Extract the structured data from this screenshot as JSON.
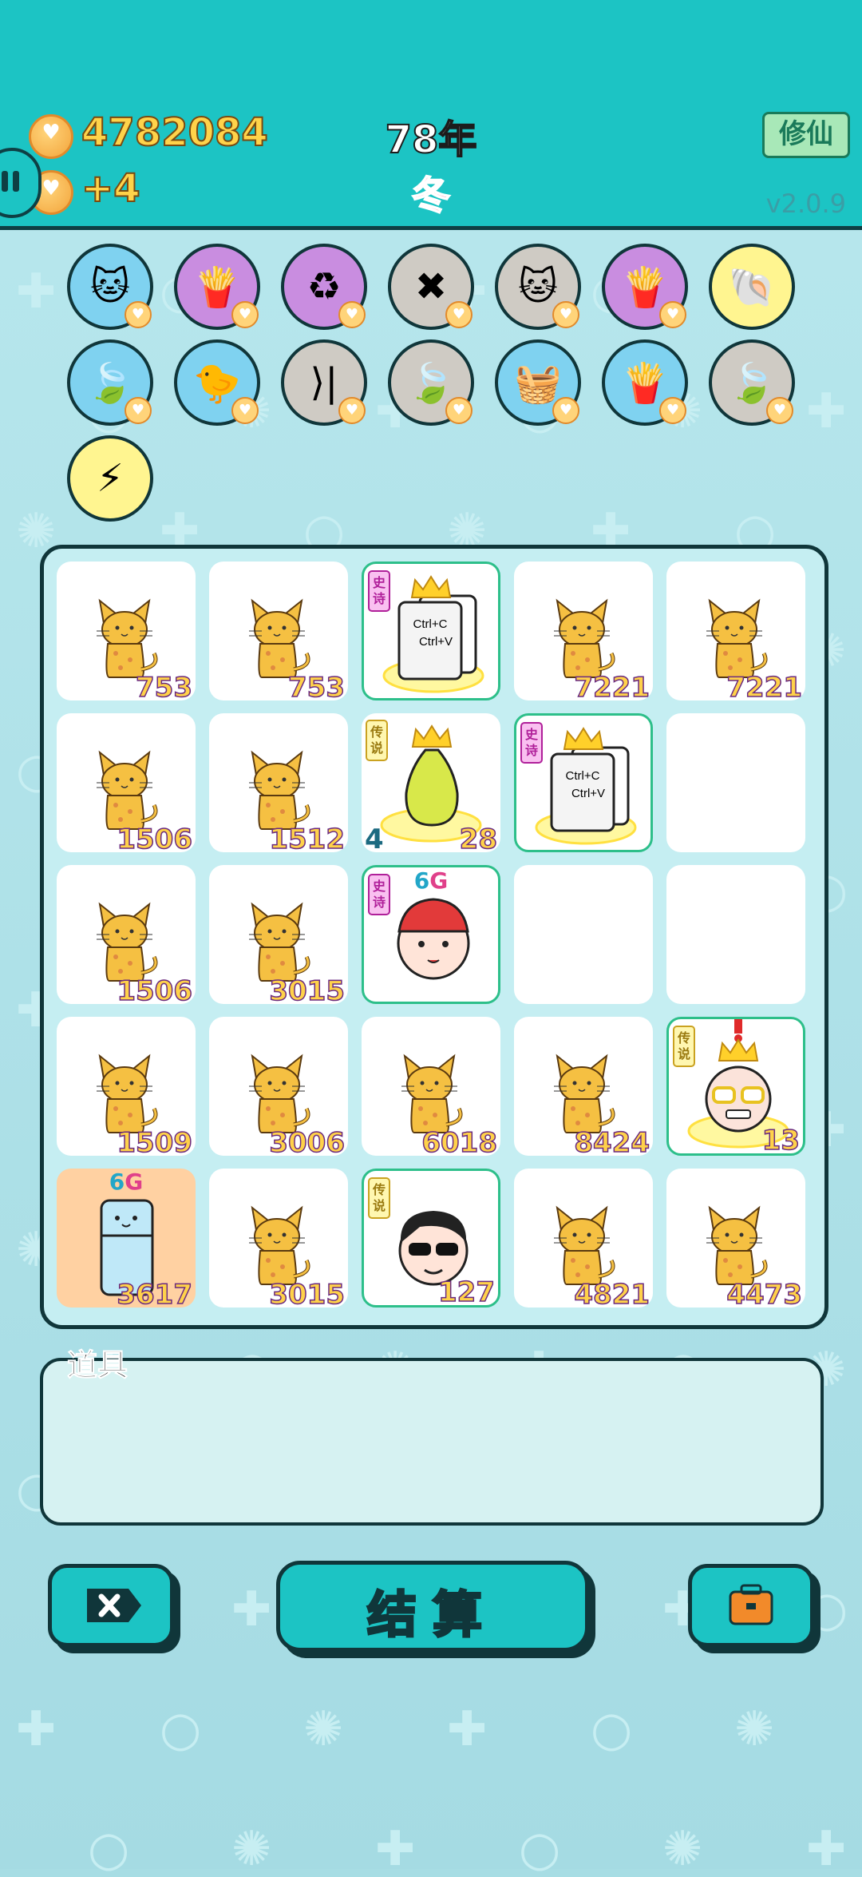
{
  "header": {
    "gold": "4782084",
    "income": "+4",
    "year": "78年",
    "season": "冬",
    "xiuxian_label": "修仙",
    "version": "v2.0.9"
  },
  "relics": [
    {
      "icon": "cat-portrait-icon",
      "glyph": "🐱",
      "color": "blue"
    },
    {
      "icon": "fries-icon",
      "glyph": "🍟",
      "color": "purple"
    },
    {
      "icon": "recycle-icon",
      "glyph": "♻",
      "color": "purple"
    },
    {
      "icon": "delete-tag-icon",
      "glyph": "✖",
      "color": "grey"
    },
    {
      "icon": "double-cat-icon",
      "glyph": "🐱",
      "color": "grey"
    },
    {
      "icon": "fries-icon",
      "glyph": "🍟",
      "color": "purple"
    },
    {
      "icon": "shell-icon",
      "glyph": "🐚",
      "color": "yellow"
    },
    {
      "icon": "leaf-icon",
      "glyph": "🍃",
      "color": "blue"
    },
    {
      "icon": "chick-egg-icon",
      "glyph": "🐤",
      "color": "blue"
    },
    {
      "icon": "skip-icon",
      "glyph": "⟩|",
      "color": "grey"
    },
    {
      "icon": "leaf-icon",
      "glyph": "🍃",
      "color": "grey"
    },
    {
      "icon": "fruit-basket-icon",
      "glyph": "🧺",
      "color": "blue"
    },
    {
      "icon": "fries-icon",
      "glyph": "🍟",
      "color": "blue"
    },
    {
      "icon": "leaf-icon",
      "glyph": "🍃",
      "color": "grey"
    },
    {
      "icon": "lightning-icon",
      "glyph": "⚡",
      "color": "yellow"
    }
  ],
  "board": [
    [
      {
        "type": "cat",
        "value": "753"
      },
      {
        "type": "cat",
        "value": "753"
      },
      {
        "type": "copy",
        "tag": "史诗",
        "value": ""
      },
      {
        "type": "cat",
        "value": "7221"
      },
      {
        "type": "cat",
        "value": "7221"
      }
    ],
    [
      {
        "type": "cat",
        "value": "1506"
      },
      {
        "type": "cat",
        "value": "1512"
      },
      {
        "type": "gourd",
        "tag": "传说",
        "left": "4",
        "value": "28"
      },
      {
        "type": "copy",
        "tag": "史诗",
        "value": ""
      },
      {
        "type": "empty",
        "value": ""
      }
    ],
    [
      {
        "type": "cat",
        "value": "1506"
      },
      {
        "type": "cat",
        "value": "3015"
      },
      {
        "type": "redhat",
        "tag": "史诗",
        "gtag": "6G",
        "value": ""
      },
      {
        "type": "empty",
        "value": ""
      },
      {
        "type": "empty",
        "value": ""
      }
    ],
    [
      {
        "type": "cat",
        "value": "1509"
      },
      {
        "type": "cat",
        "value": "3006"
      },
      {
        "type": "cat",
        "value": "6018"
      },
      {
        "type": "cat",
        "value": "8424"
      },
      {
        "type": "oldman",
        "tag": "传说",
        "value": "13"
      }
    ],
    [
      {
        "type": "fridge",
        "gtag": "6G",
        "value": "3617"
      },
      {
        "type": "cat",
        "value": "3015"
      },
      {
        "type": "sunglasses",
        "tag": "传说",
        "value": "127"
      },
      {
        "type": "cat",
        "value": "4821"
      },
      {
        "type": "cat",
        "value": "4473"
      }
    ]
  ],
  "copy_text": {
    "line1": "Ctrl+C",
    "line2": "Ctrl+V"
  },
  "items_panel": {
    "title": "道具"
  },
  "buttons": {
    "delete_icon": "close-tag-icon",
    "settle_label": "结算",
    "bag_icon": "briefcase-icon"
  },
  "colors": {
    "teal": "#1cc4c4",
    "outline": "#10363a",
    "gold": "#ffd24a"
  }
}
